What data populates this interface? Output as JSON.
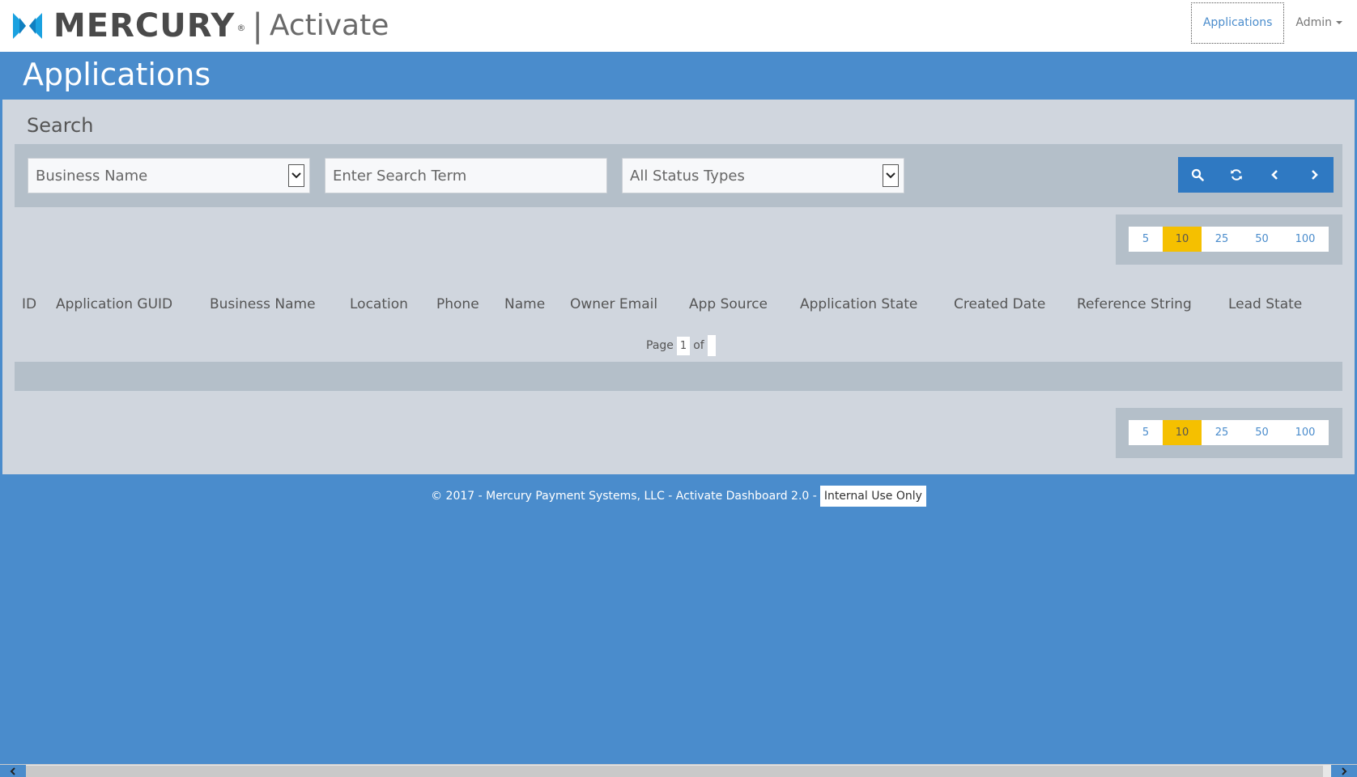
{
  "navbar": {
    "brand": "MERCURY",
    "registered": "®",
    "separator": "|",
    "product": "Activate",
    "links": {
      "applications": "Applications",
      "admin": "Admin"
    }
  },
  "page": {
    "title": "Applications"
  },
  "search": {
    "label": "Search",
    "field_select_value": "Business Name",
    "term_placeholder": "Enter Search Term",
    "status_select_value": "All Status Types",
    "buttons": [
      "search-icon",
      "refresh-icon",
      "chevron-left-icon",
      "chevron-right-icon"
    ]
  },
  "page_size": {
    "options": [
      "5",
      "10",
      "25",
      "50",
      "100"
    ],
    "selected": "10"
  },
  "table": {
    "columns": [
      "ID",
      "Application GUID",
      "Business Name",
      "Location",
      "Phone",
      "Name",
      "Owner Email",
      "App Source",
      "Application State",
      "Created Date",
      "Reference String",
      "Lead State"
    ],
    "rows": []
  },
  "pagination": {
    "page_label": "Page",
    "current_page": "1",
    "of_label": "of",
    "total_pages": ""
  },
  "footer": {
    "text": "© 2017 - Mercury Payment Systems, LLC - Activate Dashboard 2.0 -",
    "badge": "Internal Use Only"
  },
  "colors": {
    "brand_blue": "#4a8ccc",
    "button_blue": "#2f79c2",
    "panel_gray": "#d0d6de",
    "bar_gray": "#b4bfc9",
    "active_page_size": "#f5c000"
  }
}
